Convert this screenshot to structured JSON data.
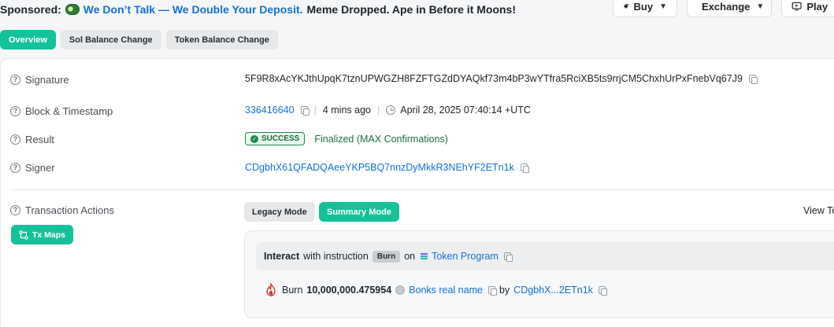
{
  "sponsor": {
    "label": "Sponsored:",
    "link_text": "We Don’t Talk — We Double Your Deposit.",
    "rest_text": "Meme Dropped. Ape in Before it Moons!"
  },
  "top_buttons": {
    "buy": "Buy",
    "exchange": "Exchange",
    "play": "Play"
  },
  "tabs": [
    {
      "label": "Overview",
      "active": true
    },
    {
      "label": "Sol Balance Change",
      "active": false
    },
    {
      "label": "Token Balance Change",
      "active": false
    }
  ],
  "details": {
    "signature": {
      "label": "Signature",
      "value": "5F9R8xAcYKJthUpqK7tznUPWGZH8FZFTGZdDYAQkf73m4bP3wYTfra5RciXB5ts9rrjCM5ChxhUrPxFnebVq67J9"
    },
    "block": {
      "label": "Block & Timestamp",
      "block": "336416640",
      "ago": "4 mins ago",
      "timestamp": "April 28, 2025 07:40:14 +UTC"
    },
    "result": {
      "label": "Result",
      "badge": "SUCCESS",
      "status": "Finalized (MAX Confirmations)"
    },
    "signer": {
      "label": "Signer",
      "value": "CDgbhX61QFADQAeeYKP5BQ7nnzDyMkkR3NEhYF2ETn1k"
    }
  },
  "actions": {
    "label": "Transaction Actions",
    "tx_maps": "Tx Maps",
    "legacy_mode": "Legacy Mode",
    "summary_mode": "Summary Mode",
    "view_to": "View To",
    "interact": {
      "prefix": "Interact",
      "with_text": "with instruction",
      "instruction": "Burn",
      "on_text": "on",
      "program": "Token Program"
    },
    "burn": {
      "verb": "Burn",
      "amount": "10,000,000.475954",
      "token": "Bonks real name",
      "by_text": "by",
      "account": "CDgbhX...2ETn1k"
    }
  },
  "colors": {
    "accent": "#14c29a",
    "link": "#1570d6",
    "success": "#1f8a4c"
  }
}
